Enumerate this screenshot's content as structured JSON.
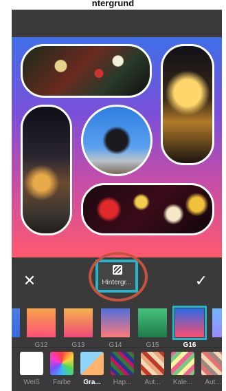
{
  "top_caption": "ntergrund",
  "toolbar": {
    "background_tool_label": "Hintergr...",
    "close_icon": "close-icon",
    "confirm_icon": "check-icon"
  },
  "gradients": [
    {
      "label": "",
      "colors": [
        "#4a7ee8",
        "#3a68e0"
      ]
    },
    {
      "label": "G12",
      "colors": [
        "#f6a348",
        "#ff4f7a"
      ]
    },
    {
      "label": "G13",
      "colors": [
        "#f3b34a",
        "#f0487a"
      ]
    },
    {
      "label": "G14",
      "colors": [
        "#4f6fdc",
        "#ff7a7a"
      ]
    },
    {
      "label": "G15",
      "colors": [
        "#46c27a",
        "#1f7a4a"
      ]
    },
    {
      "label": "G16",
      "colors": [
        "#2a6ae4",
        "#ff4d70"
      ],
      "selected": true
    },
    {
      "label": "G",
      "colors": [
        "#6fb6ff",
        "#9a8cff"
      ]
    }
  ],
  "categories": [
    {
      "label": "Weiß",
      "icon": "white-swatch"
    },
    {
      "label": "Farbe",
      "icon": "color-wheel"
    },
    {
      "label": "Gra...",
      "icon": "gradient-grid",
      "selected": true
    },
    {
      "label": "Hap...",
      "icon": "pattern-happy"
    },
    {
      "label": "Aut...",
      "icon": "pattern-autumn"
    },
    {
      "label": "Kale...",
      "icon": "pattern-calendar"
    },
    {
      "label": "Aut...",
      "icon": "pattern-autumn-2"
    }
  ],
  "colors": {
    "accent": "#25b7c9",
    "highlight_ring": "#c6533f",
    "panel": "#3a3a3a",
    "canvas_gradient": [
      "#3f6fe8",
      "#7a4fd8",
      "#c44da8",
      "#ff5a6e"
    ]
  }
}
